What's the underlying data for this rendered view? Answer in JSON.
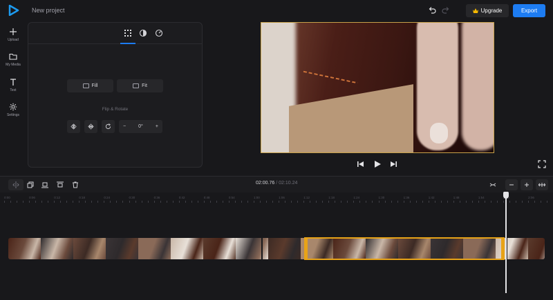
{
  "app": {
    "project_title": "New project",
    "upgrade_label": "Upgrade",
    "export_label": "Export",
    "accent_color": "#1d7cf2",
    "selection_color": "#e8a317"
  },
  "sidebar": {
    "items": [
      {
        "label": "Upload",
        "icon": "plus-icon"
      },
      {
        "label": "My Media",
        "icon": "folder-icon"
      },
      {
        "label": "Text",
        "icon": "text-icon"
      },
      {
        "label": "Settings",
        "icon": "gear-icon"
      }
    ]
  },
  "panel": {
    "tabs": [
      "grid-icon",
      "contrast-icon",
      "speed-icon"
    ],
    "fill_label": "Fill",
    "fit_label": "Fit",
    "flip_rotate_label": "Flip & Rotate",
    "rotation_value": "0°"
  },
  "playback": {
    "current_time": "02:00.76",
    "separator": "/",
    "total_time": "02:10.24"
  },
  "ruler": {
    "ticks": [
      "0:00",
      "0:06",
      "0:12",
      "0:18",
      "0:24",
      "0:30",
      "0:36",
      "0:42",
      "0:48",
      "0:54",
      "1:00",
      "1:06",
      "1:12",
      "1:18",
      "1:24",
      "1:30",
      "1:36",
      "1:42",
      "1:48",
      "1:54",
      "2:00",
      "2:06"
    ]
  }
}
